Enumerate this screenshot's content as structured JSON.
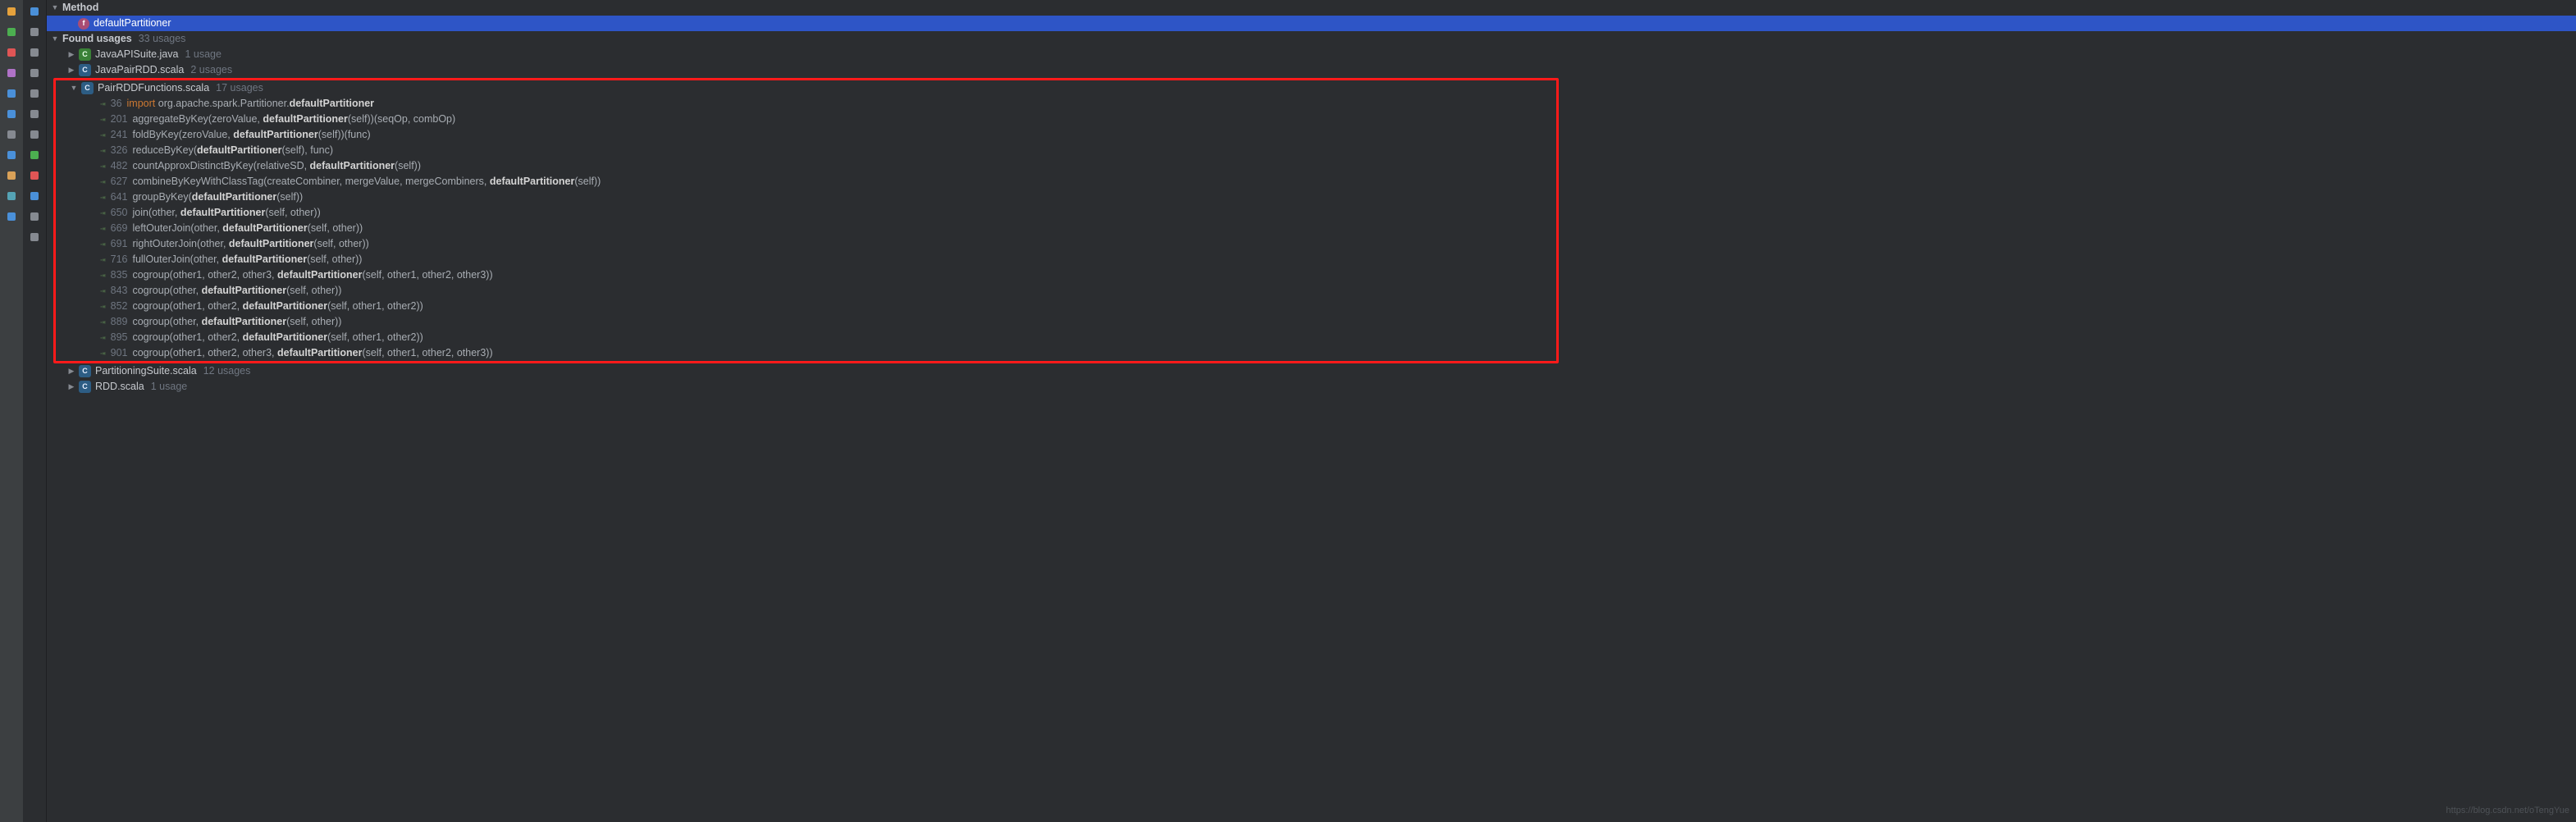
{
  "icons_left": [
    {
      "name": "target-icon",
      "color": "#e6a23c"
    },
    {
      "name": "resume-icon",
      "color": "#4caf50"
    },
    {
      "name": "stop-icon",
      "color": "#e05555"
    },
    {
      "name": "swap-icon",
      "color": "#b072c7"
    },
    {
      "name": "rotate-left-icon",
      "color": "#4a90d9"
    },
    {
      "name": "rotate-right-icon",
      "color": "#4a90d9"
    },
    {
      "name": "up-icon",
      "color": "#868a91"
    },
    {
      "name": "down-icon",
      "color": "#4a90d9"
    },
    {
      "name": "download-icon",
      "color": "#d9a158"
    },
    {
      "name": "layout-icon",
      "color": "#55a3b5"
    },
    {
      "name": "help-icon",
      "color": "#4a90d9"
    }
  ],
  "icons_secondary": [
    {
      "name": "filter-icon",
      "color": "#4a90d9"
    },
    {
      "name": "box1-icon",
      "color": "#868a91"
    },
    {
      "name": "box2-icon",
      "color": "#868a91"
    },
    {
      "name": "box3-icon",
      "color": "#868a91"
    },
    {
      "name": "box4-icon",
      "color": "#868a91"
    },
    {
      "name": "box5-icon",
      "color": "#868a91"
    },
    {
      "name": "box6-icon",
      "color": "#868a91"
    },
    {
      "name": "circle-right-icon",
      "color": "#4caf50"
    },
    {
      "name": "circle-left-icon",
      "color": "#e05555"
    },
    {
      "name": "info-icon",
      "color": "#4a90d9"
    },
    {
      "name": "box7-icon",
      "color": "#868a91"
    },
    {
      "name": "sort-icon",
      "color": "#868a91"
    }
  ],
  "header": {
    "method_label": "Method",
    "fn_name": "defaultPartitioner",
    "found_label": "Found usages",
    "found_count": "33 usages"
  },
  "files": {
    "javaapi": {
      "name": "JavaAPISuite.java",
      "usages": "1 usage"
    },
    "javapair": {
      "name": "JavaPairRDD.scala",
      "usages": "2 usages"
    },
    "pairrdd": {
      "name": "PairRDDFunctions.scala",
      "usages": "17 usages"
    },
    "partitioning": {
      "name": "PartitioningSuite.scala",
      "usages": "12 usages"
    },
    "rdd": {
      "name": "RDD.scala",
      "usages": "1 usage"
    }
  },
  "lines": [
    {
      "ln": "36",
      "pre": "",
      "kw": "import",
      "mid": " org.apache.spark.Partitioner.",
      "bold": "defaultPartitioner",
      "post": ""
    },
    {
      "ln": "201",
      "pre": "aggregateByKey(zeroValue, ",
      "bold": "defaultPartitioner",
      "post": "(self))(seqOp, combOp)"
    },
    {
      "ln": "241",
      "pre": "foldByKey(zeroValue, ",
      "bold": "defaultPartitioner",
      "post": "(self))(func)"
    },
    {
      "ln": "326",
      "pre": "reduceByKey(",
      "bold": "defaultPartitioner",
      "post": "(self), func)"
    },
    {
      "ln": "482",
      "pre": "countApproxDistinctByKey(relativeSD, ",
      "bold": "defaultPartitioner",
      "post": "(self))"
    },
    {
      "ln": "627",
      "pre": "combineByKeyWithClassTag(createCombiner, mergeValue, mergeCombiners, ",
      "bold": "defaultPartitioner",
      "post": "(self))"
    },
    {
      "ln": "641",
      "pre": "groupByKey(",
      "bold": "defaultPartitioner",
      "post": "(self))"
    },
    {
      "ln": "650",
      "pre": "join(other, ",
      "bold": "defaultPartitioner",
      "post": "(self, other))"
    },
    {
      "ln": "669",
      "pre": "leftOuterJoin(other, ",
      "bold": "defaultPartitioner",
      "post": "(self, other))"
    },
    {
      "ln": "691",
      "pre": "rightOuterJoin(other, ",
      "bold": "defaultPartitioner",
      "post": "(self, other))"
    },
    {
      "ln": "716",
      "pre": "fullOuterJoin(other, ",
      "bold": "defaultPartitioner",
      "post": "(self, other))"
    },
    {
      "ln": "835",
      "pre": "cogroup(other1, other2, other3, ",
      "bold": "defaultPartitioner",
      "post": "(self, other1, other2, other3))"
    },
    {
      "ln": "843",
      "pre": "cogroup(other, ",
      "bold": "defaultPartitioner",
      "post": "(self, other))"
    },
    {
      "ln": "852",
      "pre": "cogroup(other1, other2, ",
      "bold": "defaultPartitioner",
      "post": "(self, other1, other2))"
    },
    {
      "ln": "889",
      "pre": "cogroup(other, ",
      "bold": "defaultPartitioner",
      "post": "(self, other))"
    },
    {
      "ln": "895",
      "pre": "cogroup(other1, other2, ",
      "bold": "defaultPartitioner",
      "post": "(self, other1, other2))"
    },
    {
      "ln": "901",
      "pre": "cogroup(other1, other2, other3, ",
      "bold": "defaultPartitioner",
      "post": "(self, other1, other2, other3))"
    }
  ],
  "watermark": "https://blog.csdn.net/oTengYue"
}
